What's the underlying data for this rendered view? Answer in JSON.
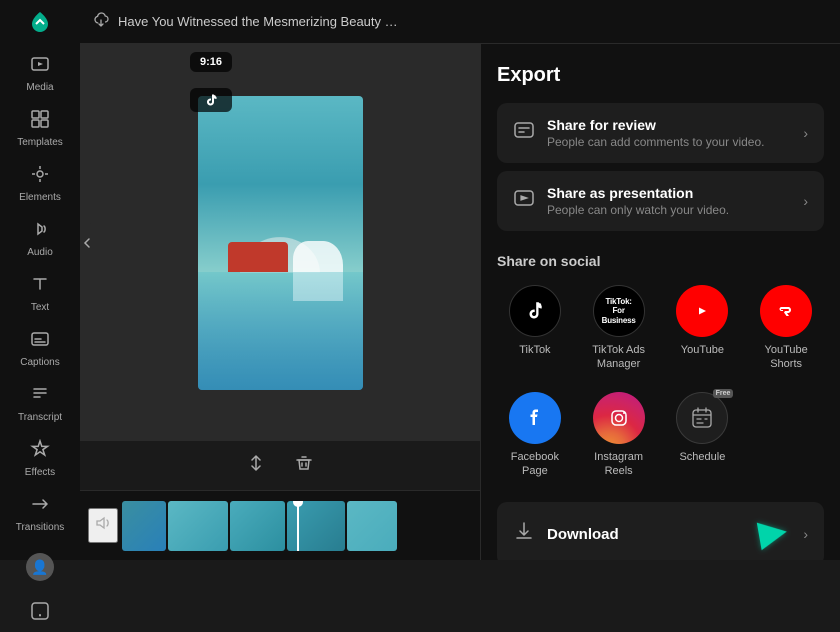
{
  "sidebar": {
    "logo": "✂",
    "items": [
      {
        "id": "media",
        "icon": "⬛",
        "label": "Media"
      },
      {
        "id": "templates",
        "icon": "⊞",
        "label": "Templates"
      },
      {
        "id": "elements",
        "icon": "❖",
        "label": "Elements"
      },
      {
        "id": "audio",
        "icon": "♪",
        "label": "Audio"
      },
      {
        "id": "text",
        "icon": "T",
        "label": "Text"
      },
      {
        "id": "captions",
        "icon": "⬜",
        "label": "Captions"
      },
      {
        "id": "transcript",
        "icon": "☰",
        "label": "Transcript"
      },
      {
        "id": "effects",
        "icon": "✦",
        "label": "Effects"
      },
      {
        "id": "transitions",
        "icon": "⇄",
        "label": "Transitions"
      }
    ],
    "bottom_items": [
      {
        "id": "account",
        "icon": "●"
      }
    ]
  },
  "topbar": {
    "title": "Have You Witnessed the Mesmerizing Beauty of Glaciers Un..."
  },
  "video": {
    "ratio": "9:16",
    "tiktok_icon": "♪"
  },
  "timeline": {
    "clips_count": 5
  },
  "export": {
    "title": "Export",
    "share_for_review": {
      "title": "Share for review",
      "description": "People can add comments to your video."
    },
    "share_as_presentation": {
      "title": "Share as presentation",
      "description": "People can only watch your video."
    },
    "share_on_social_label": "Share on social",
    "social_items": [
      {
        "id": "tiktok",
        "label": "TikTok",
        "type": "tiktok"
      },
      {
        "id": "tiktok-ads",
        "label": "TikTok Ads Manager",
        "type": "tiktok-ads",
        "text": "TikTok:\nFor Business"
      },
      {
        "id": "youtube",
        "label": "YouTube",
        "type": "youtube"
      },
      {
        "id": "youtube-shorts",
        "label": "YouTube Shorts",
        "type": "youtube-shorts"
      },
      {
        "id": "facebook",
        "label": "Facebook Page",
        "type": "facebook"
      },
      {
        "id": "instagram",
        "label": "Instagram Reels",
        "type": "instagram"
      },
      {
        "id": "schedule",
        "label": "Schedule",
        "type": "schedule",
        "free_badge": "Free"
      }
    ],
    "download": {
      "label": "Download"
    }
  }
}
